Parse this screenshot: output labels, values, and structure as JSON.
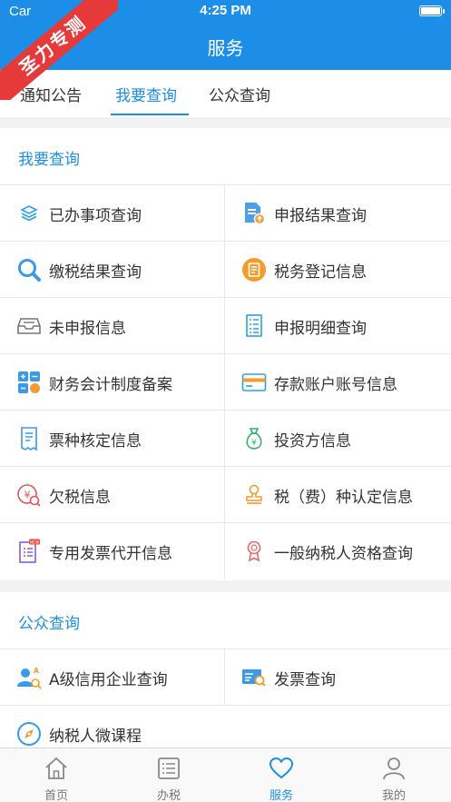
{
  "status_bar": {
    "carrier": "Car",
    "time": "4:25 PM"
  },
  "nav": {
    "title": "服务"
  },
  "watermark": {
    "text": "圣力专测"
  },
  "tabs": [
    {
      "label": "通知公告",
      "active": false
    },
    {
      "label": "我要查询",
      "active": true
    },
    {
      "label": "公众查询",
      "active": false
    }
  ],
  "sections": [
    {
      "title": "我要查询",
      "items": [
        {
          "label": "已办事项查询",
          "icon": "layers-icon"
        },
        {
          "label": "申报结果查询",
          "icon": "document-upload-icon"
        },
        {
          "label": "缴税结果查询",
          "icon": "search-icon"
        },
        {
          "label": "税务登记信息",
          "icon": "register-icon"
        },
        {
          "label": "未申报信息",
          "icon": "inbox-tray-icon"
        },
        {
          "label": "申报明细查询",
          "icon": "list-document-icon"
        },
        {
          "label": "财务会计制度备案",
          "icon": "calculator-icon"
        },
        {
          "label": "存款账户账号信息",
          "icon": "bank-card-icon"
        },
        {
          "label": "票种核定信息",
          "icon": "receipt-icon"
        },
        {
          "label": "投资方信息",
          "icon": "money-bag-icon"
        },
        {
          "label": "欠税信息",
          "icon": "yen-search-icon"
        },
        {
          "label": "税（费）种认定信息",
          "icon": "stamp-icon"
        },
        {
          "label": "专用发票代开信息",
          "icon": "new-invoice-icon"
        },
        {
          "label": "一般纳税人资格查询",
          "icon": "award-icon"
        }
      ]
    },
    {
      "title": "公众查询",
      "items": [
        {
          "label": "A级信用企业查询",
          "icon": "user-credit-icon"
        },
        {
          "label": "发票查询",
          "icon": "invoice-search-icon"
        },
        {
          "label": "纳税人微课程",
          "icon": "compass-icon"
        }
      ]
    }
  ],
  "bottom_nav": [
    {
      "label": "首页",
      "icon": "home-icon",
      "active": false
    },
    {
      "label": "办税",
      "icon": "list-icon",
      "active": false
    },
    {
      "label": "服务",
      "icon": "heart-icon",
      "active": true
    },
    {
      "label": "我的",
      "icon": "profile-icon",
      "active": false
    }
  ],
  "colors": {
    "primary": "#1d8ee8",
    "ribbon": "#e63a3a",
    "orange": "#f39c2c"
  }
}
